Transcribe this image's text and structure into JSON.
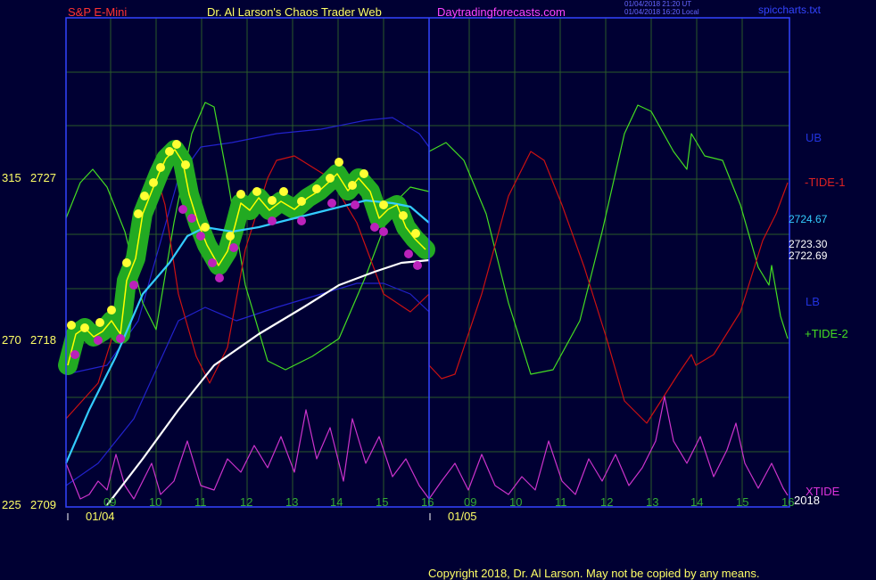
{
  "header": {
    "symbol": "S&P E-Mini",
    "site_title": "Dr. Al Larson's Chaos Trader Web",
    "site_url": "Daytradingforecasts.com",
    "timestamp_ut": "01/04/2018 21:20 UT",
    "timestamp_local": "01/04/2018 16:20 Local",
    "file": "spiccharts.txt"
  },
  "footer": {
    "copyright": "Copyright 2018, Dr. Al Larson. May not be copied by any means.",
    "year": "2018"
  },
  "colors": {
    "background": "#000033",
    "frame": "#3344ff",
    "grid": "#2a5a2a",
    "price": "#ffff00",
    "ma_short": "#33ccff",
    "ma_long": "#ffffff",
    "bands": "#2222cc",
    "tide1": "#cc1111",
    "tide2": "#44dd22",
    "xtide": "#cc33cc",
    "glow": "#22aa22",
    "up_dot": "#ffff33",
    "down_dot": "#bb22bb"
  },
  "chart_data": {
    "type": "line",
    "y_axis_left": [
      {
        "tide": "315",
        "price": "2727"
      },
      {
        "tide": "270",
        "price": "2718"
      },
      {
        "tide": "225",
        "price": "2709"
      }
    ],
    "ylim": [
      2709,
      2727
    ],
    "x_hours": [
      "09",
      "10",
      "11",
      "12",
      "13",
      "14",
      "15",
      "16",
      "09",
      "10",
      "11",
      "12",
      "13",
      "14",
      "15",
      "16"
    ],
    "x_dates": [
      "01/04",
      "01/05"
    ],
    "right_labels": {
      "ub": "UB",
      "tide1": "-TIDE-1",
      "lb": "LB",
      "tide2": "+TIDE-2",
      "xtide": "XTIDE"
    },
    "price_labels": {
      "ma_short": "2724.67",
      "last": "2723.30",
      "ma_long": "2722.69"
    },
    "series": [
      {
        "name": "UB"
      },
      {
        "name": "LB"
      },
      {
        "name": "-TIDE-1"
      },
      {
        "name": "+TIDE-2"
      },
      {
        "name": "XTIDE"
      }
    ]
  }
}
